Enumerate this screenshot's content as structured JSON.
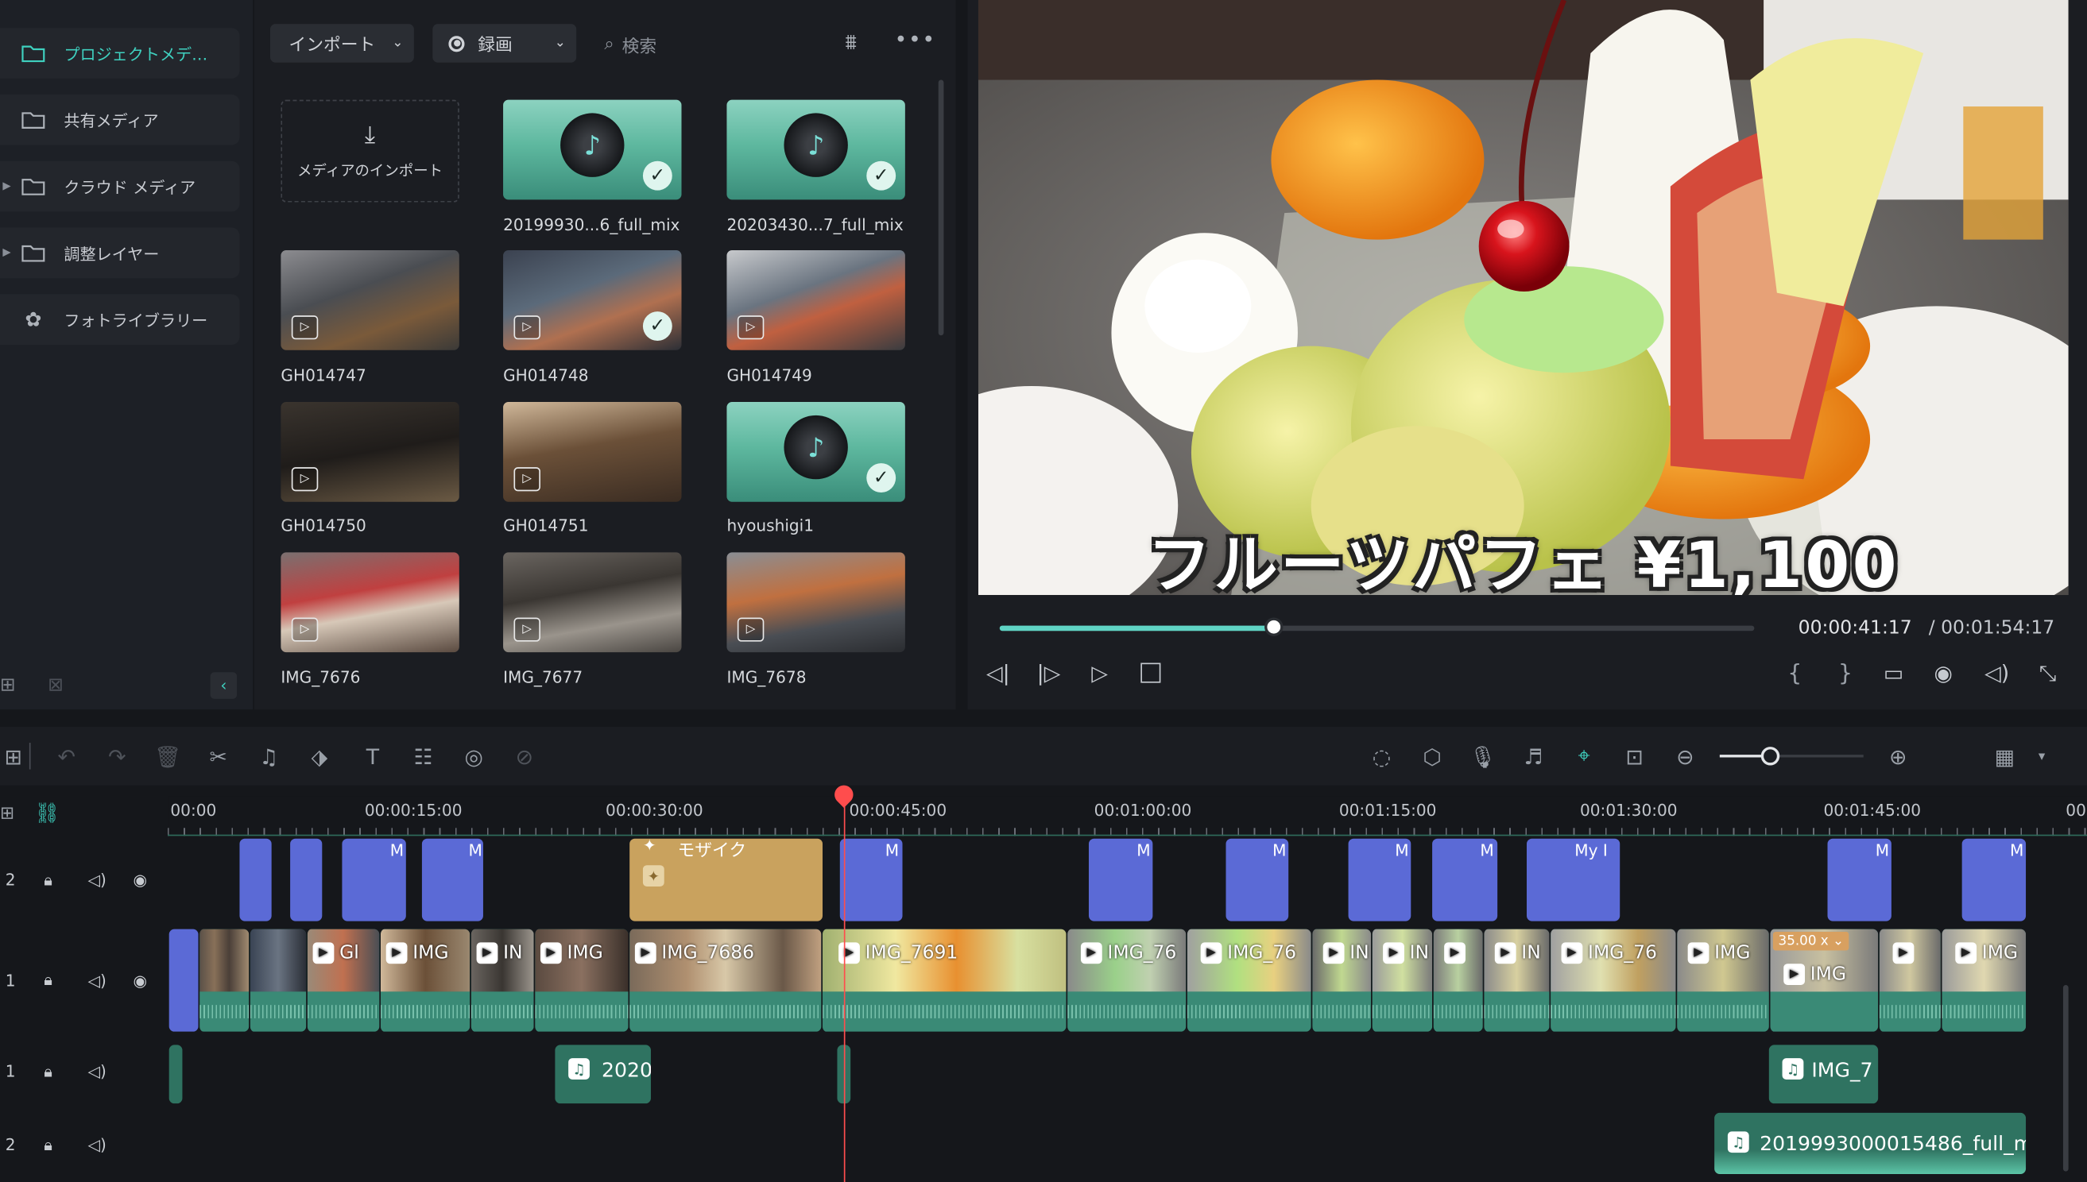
{
  "sidebar": {
    "items": [
      {
        "label": "プロジェクトメデ…",
        "icon": "folder-icon",
        "active": true
      },
      {
        "label": "共有メディア",
        "icon": "folder-icon"
      },
      {
        "label": "クラウド メディア",
        "icon": "folder-icon"
      },
      {
        "label": "調整レイヤー",
        "icon": "folder-icon"
      },
      {
        "label": "フォトライブラリー",
        "icon": "photos-icon"
      }
    ]
  },
  "media_toolbar": {
    "import_label": "インポート",
    "record_label": "録画",
    "search_placeholder": "検索"
  },
  "media": {
    "import_tile_label": "メディアのインポート",
    "items": [
      {
        "name": "20199930...6_full_mix",
        "kind": "audio",
        "checked": true
      },
      {
        "name": "20203430...7_full_mix",
        "kind": "audio",
        "checked": true
      },
      {
        "name": "GH014747",
        "kind": "video",
        "checked": false
      },
      {
        "name": "GH014748",
        "kind": "video",
        "checked": true
      },
      {
        "name": "GH014749",
        "kind": "video",
        "checked": false
      },
      {
        "name": "GH014750",
        "kind": "video",
        "checked": false
      },
      {
        "name": "GH014751",
        "kind": "video",
        "checked": false
      },
      {
        "name": "hyoushigi1",
        "kind": "audio",
        "checked": true
      },
      {
        "name": "IMG_7676",
        "kind": "video",
        "checked": false
      },
      {
        "name": "IMG_7677",
        "kind": "video",
        "checked": false
      },
      {
        "name": "IMG_7678",
        "kind": "video",
        "checked": false
      }
    ]
  },
  "preview": {
    "caption": "フルーツパフェ ¥1,100",
    "current_time": "00:00:41:17",
    "total_time": "/ 00:01:54:17",
    "progress": 0.363,
    "accent": "#5fd3c4"
  },
  "timeline": {
    "zoom_level": 0.35,
    "ruler": [
      "00:00",
      "00:00:15:00",
      "00:00:30:00",
      "00:00:45:00",
      "00:01:00:00",
      "00:01:15:00",
      "00:01:30:00",
      "00:01:45:00",
      "00:"
    ],
    "tracks": [
      {
        "number": "2",
        "type": "title"
      },
      {
        "number": "1",
        "type": "video"
      },
      {
        "number": "1",
        "type": "audio"
      },
      {
        "number": "2",
        "type": "audio"
      }
    ],
    "title_clips": [
      "M",
      "M",
      "M",
      "M",
      "M",
      "M",
      "M",
      "My I",
      "M",
      "M"
    ],
    "mosaic_label": "モザイク",
    "video_clips": [
      "IMG",
      "IMG",
      "IMG_7686",
      "IMG_7691",
      "IMG_76",
      "IMG_76",
      "IMG_76",
      "IMG",
      "IMG",
      "IMG",
      "Gl",
      "IN",
      "IN",
      "IN",
      "IN"
    ],
    "speed_badge": "35.00 x",
    "audio_clips": [
      "2020",
      "IMG_7",
      "2019993000015486_full_m"
    ],
    "colors": {
      "title": "#5b6ad6",
      "mosaic": "#c9a25e",
      "clip": "#2f7361",
      "playhead": "#ff4d4d"
    }
  }
}
